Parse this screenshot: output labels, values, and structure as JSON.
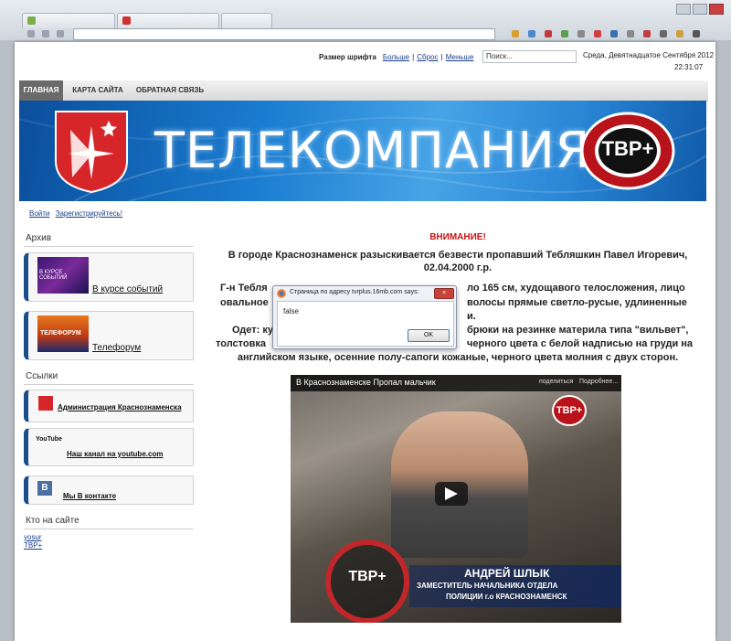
{
  "browser": {
    "dialog_title": "Страница по адресу tvrplus.16mb.com says:",
    "dialog_message": "false",
    "dialog_ok": "OK"
  },
  "topbar": {
    "font_size_label": "Размер шрифта",
    "bigger": "Больше",
    "reset": "Сброс",
    "smaller": "Меньше",
    "search_placeholder": "Поиск...",
    "date": "Среда, Девятнадцатое Сентября 2012",
    "time": "22:31:07"
  },
  "nav": [
    {
      "label": "ГЛАВНАЯ"
    },
    {
      "label": "КАРТА САЙТА"
    },
    {
      "label": "ОБРАТНАЯ СВЯЗЬ"
    }
  ],
  "banner": {
    "title": "ТЕЛЕКОМПАНИЯ",
    "logo_text": "ТВР+"
  },
  "auth": {
    "login": "Войти",
    "register": "Зарегистрируйтесь!"
  },
  "sidebar": {
    "archive_heading": "Архив",
    "archive_items": [
      {
        "label": "В курсе событий",
        "thumb_text": "В КУРСЕ СОБЫТИЙ"
      },
      {
        "label": "Телефорум",
        "thumb_text": "ТЕЛЕФОРУМ"
      }
    ],
    "links_heading": "Ссылки",
    "links": [
      {
        "label": "Администрация Краснознаменска"
      },
      {
        "label": "Наш канал на youtube.com",
        "icon_text": "YouTube"
      },
      {
        "label": "Мы В контакте",
        "icon_text": "B"
      }
    ],
    "online_heading": "Кто на сайте",
    "online_users": [
      "yosur",
      "TBP+"
    ]
  },
  "content": {
    "attention": "ВНИМАНИЕ!",
    "p1": "В городе Краснознаменск разыскивается безвести пропавший Тебляшкин Павел Игоревич, 02.04.2000 г.р.",
    "p2_left": "Г-н Тебля",
    "p2_right": "ло 165 см,  худощавого телосложения, лицо",
    "p2b_left": "овальное",
    "p2b_right": "волосы прямые светло-русые, удлиненные",
    "p2c_right": "и.",
    "p3_left": "Одет: ку",
    "p3_right": "брюки на резинке материла типа \"вильвет\",",
    "p3b_left": "толстовка",
    "p3b_right": "черного цвета с белой надписью на груди на",
    "p3c": "английском языке, осенние полу-сапоги кожаные,  черного цвета  молния с двух сторон."
  },
  "video": {
    "title": "В Краснознаменске Пропал мальчик",
    "share": "поделиться",
    "more": "Подробнее...",
    "logo": "ТВР+",
    "caption_name": "АНДРЕЙ ШЛЫК",
    "caption_role1": "ЗАМЕСТИТЕЛЬ НАЧАЛЬНИКА ОТДЕЛА",
    "caption_role2": "ПОЛИЦИИ г.о КРАСНОЗНАМЕНСК"
  },
  "colors": {
    "nav_active": "#6a6a6a",
    "attention_red": "#cc1010",
    "sidebox_accent": "#1a4d8a",
    "link": "#1a3e8c"
  }
}
